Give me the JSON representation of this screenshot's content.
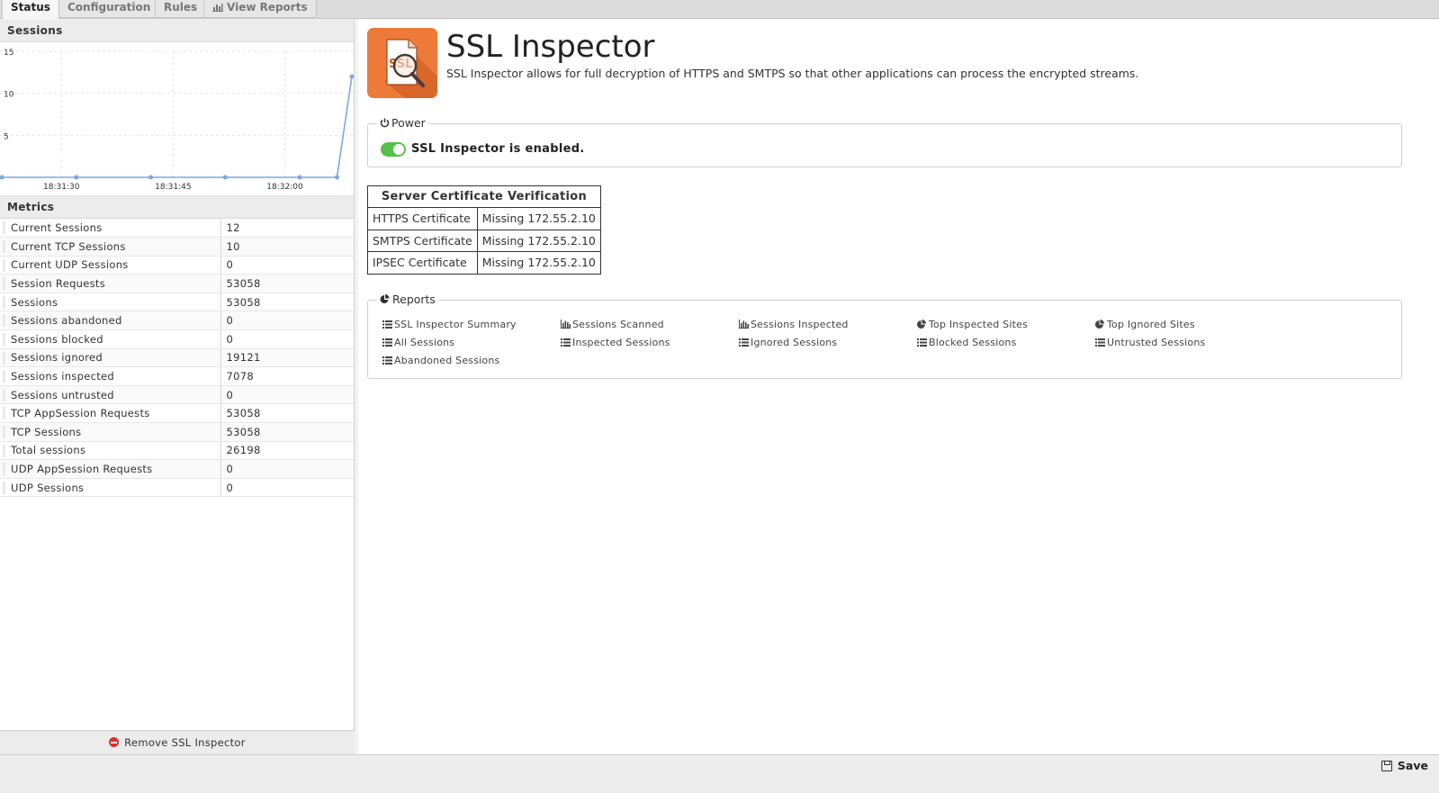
{
  "tabs": [
    {
      "label": "Status",
      "active": true
    },
    {
      "label": "Configuration"
    },
    {
      "label": "Rules"
    },
    {
      "label": "View Reports",
      "icon": "chart-icon"
    }
  ],
  "sessions_panel": {
    "title": "Sessions"
  },
  "chart_data": {
    "type": "line",
    "x": [
      "18:31:22",
      "18:31:27",
      "18:31:32",
      "18:31:37",
      "18:31:42",
      "18:31:47",
      "18:31:52",
      "18:31:57",
      "18:32:02",
      "18:32:07",
      "18:32:09"
    ],
    "series": [
      {
        "values": [
          0,
          null,
          0,
          null,
          0,
          null,
          0,
          null,
          0,
          0,
          12
        ]
      }
    ],
    "xticks": [
      "18:31:30",
      "18:31:45",
      "18:32:00"
    ],
    "yticks": [
      "15",
      "10",
      "5"
    ],
    "ylim": [
      0,
      15
    ],
    "grid": true,
    "color": "#7aa9e0"
  },
  "metrics_panel": {
    "title": "Metrics",
    "rows": [
      {
        "name": "Current Sessions",
        "value": "12"
      },
      {
        "name": "Current TCP Sessions",
        "value": "10"
      },
      {
        "name": "Current UDP Sessions",
        "value": "0"
      },
      {
        "name": "Session Requests",
        "value": "53058"
      },
      {
        "name": "Sessions",
        "value": "53058"
      },
      {
        "name": "Sessions abandoned",
        "value": "0"
      },
      {
        "name": "Sessions blocked",
        "value": "0"
      },
      {
        "name": "Sessions ignored",
        "value": "19121"
      },
      {
        "name": "Sessions inspected",
        "value": "7078"
      },
      {
        "name": "Sessions untrusted",
        "value": "0"
      },
      {
        "name": "TCP AppSession Requests",
        "value": "53058"
      },
      {
        "name": "TCP Sessions",
        "value": "53058"
      },
      {
        "name": "Total sessions",
        "value": "26198"
      },
      {
        "name": "UDP AppSession Requests",
        "value": "0"
      },
      {
        "name": "UDP Sessions",
        "value": "0"
      }
    ]
  },
  "remove_label": "Remove SSL Inspector",
  "app": {
    "title": "SSL Inspector",
    "icon_text": "SSL",
    "description": "SSL Inspector allows for full decryption of HTTPS and SMTPS so that other applications can process the encrypted streams.",
    "brand_color": "#ee7a3a"
  },
  "power": {
    "legend": "Power",
    "status": "SSL Inspector is enabled.",
    "enabled": true,
    "color": "#54c248"
  },
  "certificates": {
    "title": "Server Certificate Verification",
    "rows": [
      {
        "name": "HTTPS Certificate",
        "status": "Missing 172.55.2.10"
      },
      {
        "name": "SMTPS Certificate",
        "status": "Missing 172.55.2.10"
      },
      {
        "name": "IPSEC Certificate",
        "status": "Missing 172.55.2.10"
      }
    ]
  },
  "reports": {
    "legend": "Reports",
    "links": [
      {
        "label": "SSL Inspector Summary",
        "icon": "list-icon"
      },
      {
        "label": "Sessions Scanned",
        "icon": "bar-chart-icon"
      },
      {
        "label": "Sessions Inspected",
        "icon": "bar-chart-icon"
      },
      {
        "label": "Top Inspected Sites",
        "icon": "pie-chart-icon"
      },
      {
        "label": "Top Ignored Sites",
        "icon": "pie-chart-icon"
      },
      {
        "label": "All Sessions",
        "icon": "list-icon"
      },
      {
        "label": "Inspected Sessions",
        "icon": "list-icon"
      },
      {
        "label": "Ignored Sessions",
        "icon": "list-icon"
      },
      {
        "label": "Blocked Sessions",
        "icon": "list-icon"
      },
      {
        "label": "Untrusted Sessions",
        "icon": "list-icon"
      },
      {
        "label": "Abandoned Sessions",
        "icon": "list-icon"
      }
    ]
  },
  "save_label": "Save"
}
